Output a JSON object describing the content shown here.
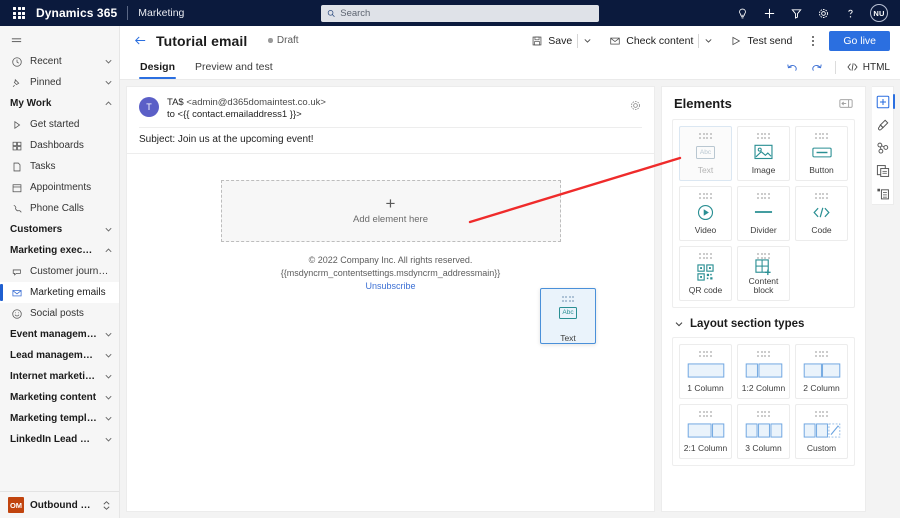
{
  "topnav": {
    "waffle_icon": "app-launcher-icon",
    "brand": "Dynamics 365",
    "app_name": "Marketing",
    "search": {
      "placeholder": "Search",
      "value": "",
      "icon": "search-icon"
    },
    "icons": [
      "lightbulb-icon",
      "plus-icon",
      "filter-icon",
      "gear-icon",
      "help-icon"
    ],
    "avatar_initials": "NU"
  },
  "sidebar": {
    "hamburger_icon": "hamburger-icon",
    "items": [
      {
        "label": "Recent",
        "icon": "clock-icon",
        "type": "expandable",
        "expanded": false
      },
      {
        "label": "Pinned",
        "icon": "pin-icon",
        "type": "expandable",
        "expanded": false
      },
      {
        "label": "My Work",
        "icon": "",
        "type": "group",
        "expanded": true
      },
      {
        "label": "Get started",
        "icon": "play-icon",
        "type": "link"
      },
      {
        "label": "Dashboards",
        "icon": "dashboard-icon",
        "type": "link"
      },
      {
        "label": "Tasks",
        "icon": "task-icon",
        "type": "link"
      },
      {
        "label": "Appointments",
        "icon": "calendar-icon",
        "type": "link"
      },
      {
        "label": "Phone Calls",
        "icon": "phone-icon",
        "type": "link"
      },
      {
        "label": "Customers",
        "icon": "",
        "type": "group",
        "expanded": false
      },
      {
        "label": "Marketing execution",
        "icon": "",
        "type": "group",
        "expanded": true
      },
      {
        "label": "Customer journeys",
        "icon": "journey-icon",
        "type": "link"
      },
      {
        "label": "Marketing emails",
        "icon": "envelope-icon",
        "type": "link",
        "selected": true
      },
      {
        "label": "Social posts",
        "icon": "social-icon",
        "type": "link"
      },
      {
        "label": "Event management",
        "icon": "",
        "type": "group",
        "expanded": false
      },
      {
        "label": "Lead management",
        "icon": "",
        "type": "group",
        "expanded": false
      },
      {
        "label": "Internet marketing",
        "icon": "",
        "type": "group",
        "expanded": false
      },
      {
        "label": "Marketing content",
        "icon": "",
        "type": "group",
        "expanded": false
      },
      {
        "label": "Marketing templates",
        "icon": "",
        "type": "group",
        "expanded": false
      },
      {
        "label": "LinkedIn Lead Gen",
        "icon": "",
        "type": "group",
        "expanded": false
      }
    ],
    "footer": {
      "badge": "OM",
      "label": "Outbound market...",
      "switcher_icon": "app-switcher-icon"
    }
  },
  "command_bar": {
    "back_icon": "back-arrow-icon",
    "title": "Tutorial email",
    "status": "Draft",
    "save_label": "Save",
    "save_icon": "save-icon",
    "check_content_label": "Check content",
    "check_content_icon": "check-content-icon",
    "test_send_label": "Test send",
    "test_send_icon": "send-icon",
    "overflow_icon": "more-options-icon",
    "go_live_label": "Go live"
  },
  "tabs": {
    "items": [
      {
        "label": "Design",
        "active": true
      },
      {
        "label": "Preview and test",
        "active": false
      }
    ],
    "tools": {
      "undo_icon": "undo-icon",
      "redo_icon": "redo-icon",
      "html_label": "HTML",
      "html_icon": "code-icon"
    }
  },
  "canvas": {
    "avatar_initial": "T",
    "from_name": "TA$",
    "from_address": "<admin@d365domaintest.co.uk>",
    "to_line": "to <{{ contact.emailaddress1 }}>",
    "settings_icon": "gear-icon",
    "subject_label": "Subject:",
    "subject_value": "Join us at the upcoming event!",
    "dropzone": {
      "plus": "+",
      "label": "Add element here"
    },
    "drag_ghost": {
      "label": "Text",
      "icon": "abc-icon"
    },
    "footer": {
      "copyright": "© 2022 Company Inc. All rights reserved.",
      "address_token": "{{msdyncrm_contentsettings.msdyncrm_addressmain}}",
      "unsubscribe": "Unsubscribe"
    }
  },
  "elements_panel": {
    "title": "Elements",
    "collapse_icon": "collapse-panel-icon",
    "elements": [
      {
        "label": "Text",
        "icon": "abc-icon",
        "ghosted": true
      },
      {
        "label": "Image",
        "icon": "image-icon",
        "ghosted": false
      },
      {
        "label": "Button",
        "icon": "button-icon",
        "ghosted": false
      },
      {
        "label": "Video",
        "icon": "video-icon",
        "ghosted": false
      },
      {
        "label": "Divider",
        "icon": "divider-icon",
        "ghosted": false
      },
      {
        "label": "Code",
        "icon": "code-icon",
        "ghosted": false
      },
      {
        "label": "QR code",
        "icon": "qr-code-icon",
        "ghosted": false
      },
      {
        "label": "Content block",
        "icon": "content-block-icon",
        "ghosted": false
      }
    ],
    "layout_section": {
      "title": "Layout section types",
      "chevron_icon": "chevron-down-icon",
      "layouts": [
        {
          "label": "1 Column",
          "cols": [
            1
          ]
        },
        {
          "label": "1:2 Column",
          "cols": [
            1,
            2
          ]
        },
        {
          "label": "2 Column",
          "cols": [
            1,
            1
          ]
        },
        {
          "label": "2:1 Column",
          "cols": [
            2,
            1
          ]
        },
        {
          "label": "3 Column",
          "cols": [
            1,
            1,
            1
          ]
        },
        {
          "label": "Custom",
          "cols": [
            1,
            1,
            1
          ]
        }
      ]
    }
  },
  "right_rail": {
    "buttons": [
      {
        "icon": "elements-icon",
        "active": true
      },
      {
        "icon": "styles-brush-icon",
        "active": false
      },
      {
        "icon": "personalization-icon",
        "active": false
      },
      {
        "icon": "assets-library-icon",
        "active": false
      },
      {
        "icon": "summary-list-icon",
        "active": false
      }
    ]
  },
  "annotation": {
    "arrow_color": "#ef2b2b"
  }
}
